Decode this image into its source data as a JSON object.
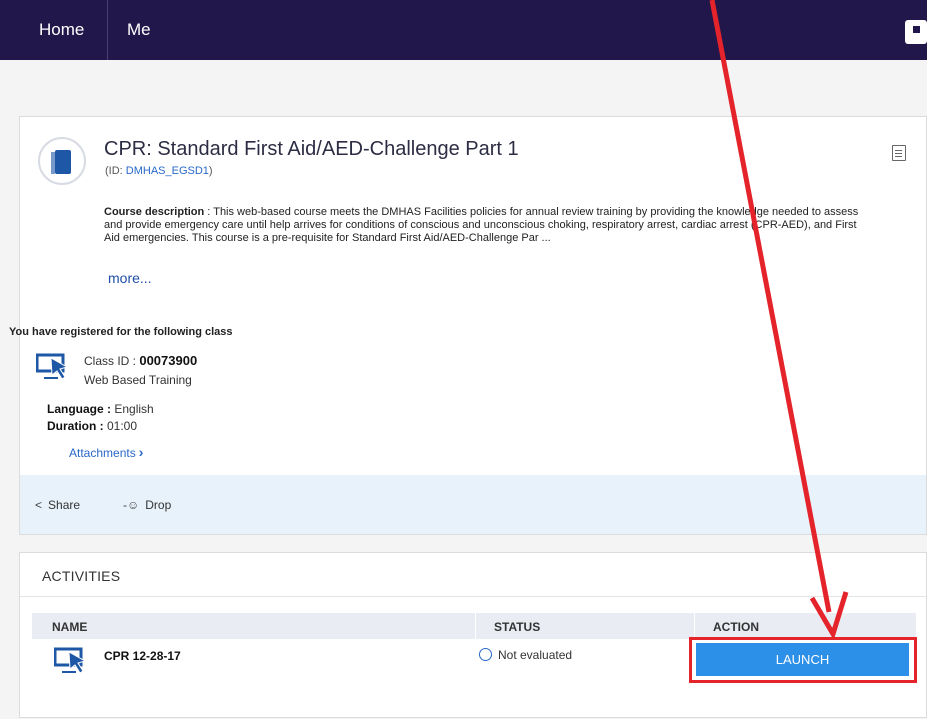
{
  "nav": {
    "home": "Home",
    "me": "Me"
  },
  "course": {
    "title": "CPR: Standard First Aid/AED-Challenge Part 1",
    "id_prefix": "(ID: ",
    "id_value": "DMHAS_EGSD1",
    "id_suffix": ")",
    "description_label": "Course description",
    "description_text": " : This web-based course meets the DMHAS Facilities policies for annual review training by providing the knowledge needed to assess and provide emergency care until help arrives for conditions of conscious and unconscious choking, respiratory arrest, cardiac arrest (CPR-AED), and First Aid emergencies. This course is a pre-requisite for Standard First Aid/AED-Challenge Par ...",
    "more": "more..."
  },
  "registration": {
    "heading": "You have registered for the following class",
    "class_id_label": "Class ID : ",
    "class_id_value": "00073900",
    "class_type": "Web Based Training",
    "language_label": "Language : ",
    "language_value": "English",
    "duration_label": "Duration : ",
    "duration_value": "01:00",
    "attachments": "Attachments"
  },
  "actions": {
    "share": "Share",
    "drop": "Drop"
  },
  "activities": {
    "title": "ACTIVITIES",
    "columns": {
      "name": "NAME",
      "status": "STATUS",
      "action": "ACTION"
    },
    "rows": [
      {
        "name": "CPR 12-28-17",
        "status": "Not evaluated",
        "action": "LAUNCH"
      }
    ]
  },
  "colors": {
    "nav_bg": "#22174a",
    "launch_bg": "#2c8fe8",
    "annotation_red": "#e4232b",
    "link": "#2868c8"
  },
  "icons": [
    "book-icon",
    "document-icon",
    "computer-cursor-icon",
    "share-icon",
    "drop-user-icon",
    "status-circle-icon",
    "chevron-right-icon"
  ]
}
